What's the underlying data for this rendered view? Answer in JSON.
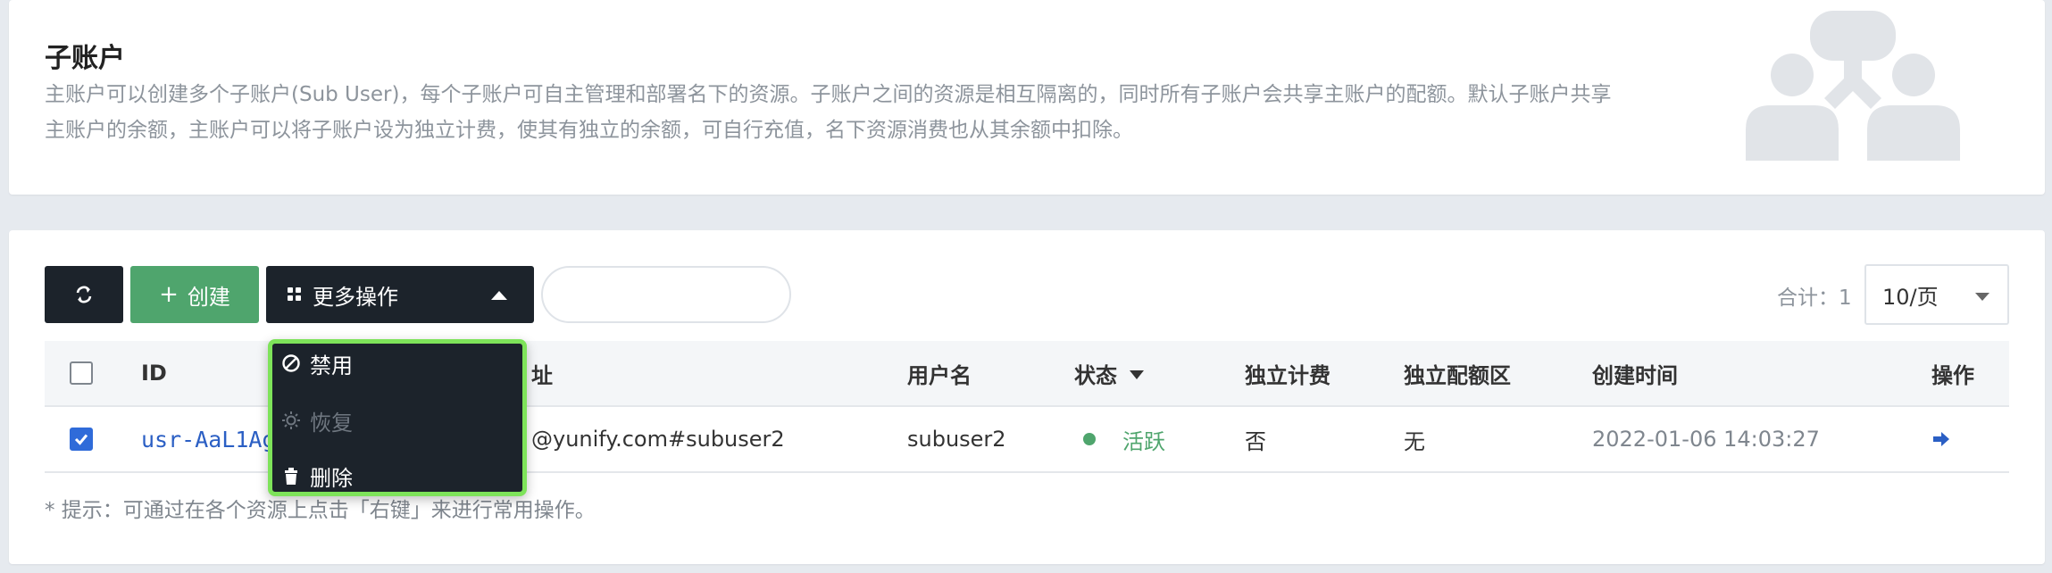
{
  "intro": {
    "title": "子账户",
    "description": "主账户可以创建多个子账户(Sub User)，每个子账户可自主管理和部署名下的资源。子账户之间的资源是相互隔离的，同时所有子账户会共享主账户的配额。默认子账户共享主账户的余额，主账户可以将子账户设为独立计费，使其有独立的余额，可自行充值，名下资源消费也从其余额中扣除。"
  },
  "toolbar": {
    "refresh_icon": "refresh-icon",
    "create_label": "创建",
    "more_label": "更多操作",
    "search_placeholder": "",
    "total_text": "合计：1",
    "page_size": "10/页"
  },
  "dropdown": {
    "items": [
      {
        "label": "禁用",
        "icon": "ban-icon",
        "enabled": true
      },
      {
        "label": "恢复",
        "icon": "sun-icon",
        "enabled": false
      },
      {
        "label": "删除",
        "icon": "trash-icon",
        "enabled": true
      }
    ]
  },
  "table": {
    "headers": {
      "id": "ID",
      "address": "址",
      "username": "用户名",
      "status": "状态",
      "billing": "独立计费",
      "quota": "独立配额区",
      "created": "创建时间",
      "actions": "操作"
    },
    "rows": [
      {
        "checked": true,
        "id": "usr-AaL1Ag",
        "address": "@yunify.com#subuser2",
        "username": "subuser2",
        "status": "活跃",
        "billing": "否",
        "quota": "无",
        "created": "2022-01-06 14:03:27",
        "action_icon": "arrow-right-icon"
      }
    ]
  },
  "hint": "* 提示：可通过在各个资源上点击「右键」来进行常用操作。",
  "colors": {
    "primary_dark": "#1c232b",
    "create_green": "#4fa56d",
    "link_blue": "#2b5fc4",
    "highlight_green": "#7ee35a"
  }
}
